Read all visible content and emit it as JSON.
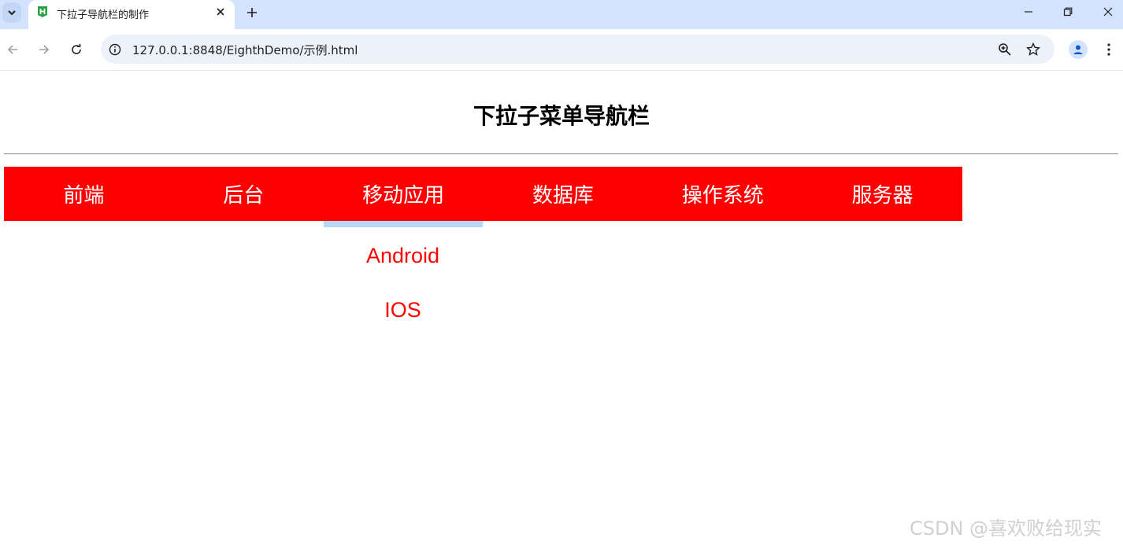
{
  "browser": {
    "tab_title": "下拉子导航栏的制作",
    "url": "127.0.0.1:8848/EighthDemo/示例.html"
  },
  "page": {
    "title": "下拉子菜单导航栏",
    "nav": [
      {
        "label": "前端"
      },
      {
        "label": "后台"
      },
      {
        "label": "移动应用"
      },
      {
        "label": "数据库"
      },
      {
        "label": "操作系统"
      },
      {
        "label": "服务器"
      }
    ],
    "dropdown": [
      "Android",
      "IOS"
    ],
    "colors": {
      "nav_bg": "#ff0000",
      "active_bar": "#b7d8f8",
      "dropdown_text": "#ff0000"
    }
  },
  "watermark": "CSDN @喜欢败给现实"
}
